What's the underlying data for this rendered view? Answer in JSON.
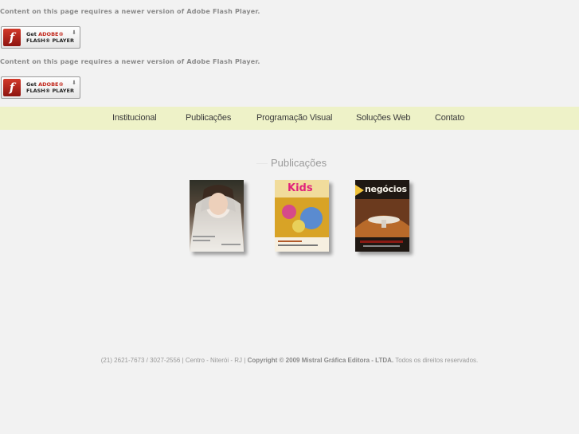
{
  "flash": {
    "message": "Content on this page requires a newer version of Adobe Flash Player.",
    "badge_get": "Get",
    "badge_adobe": "ADOBE®",
    "badge_player": "FLASH® PLAYER",
    "badge_icon": "f"
  },
  "nav": {
    "items": [
      "Institucional",
      "Publicações",
      "Programação Visual",
      "Soluções Web",
      "Contato"
    ]
  },
  "section": {
    "title": "Publicações"
  },
  "covers": {
    "kids_title": "Kids",
    "negocios_title": "negócios"
  },
  "footer": {
    "phones": "(21) 2621-7673 / 3027-2556",
    "location": "Centro - Niterói - RJ",
    "copyright": "Copyright © 2009 Mistral Gráfica Editora - LTDA.",
    "rights": "Todos os direitos reservados."
  },
  "colors": {
    "nav_bg": "#eef2c8",
    "background": "#f2f2f2",
    "flash_red": "#c2261a"
  }
}
